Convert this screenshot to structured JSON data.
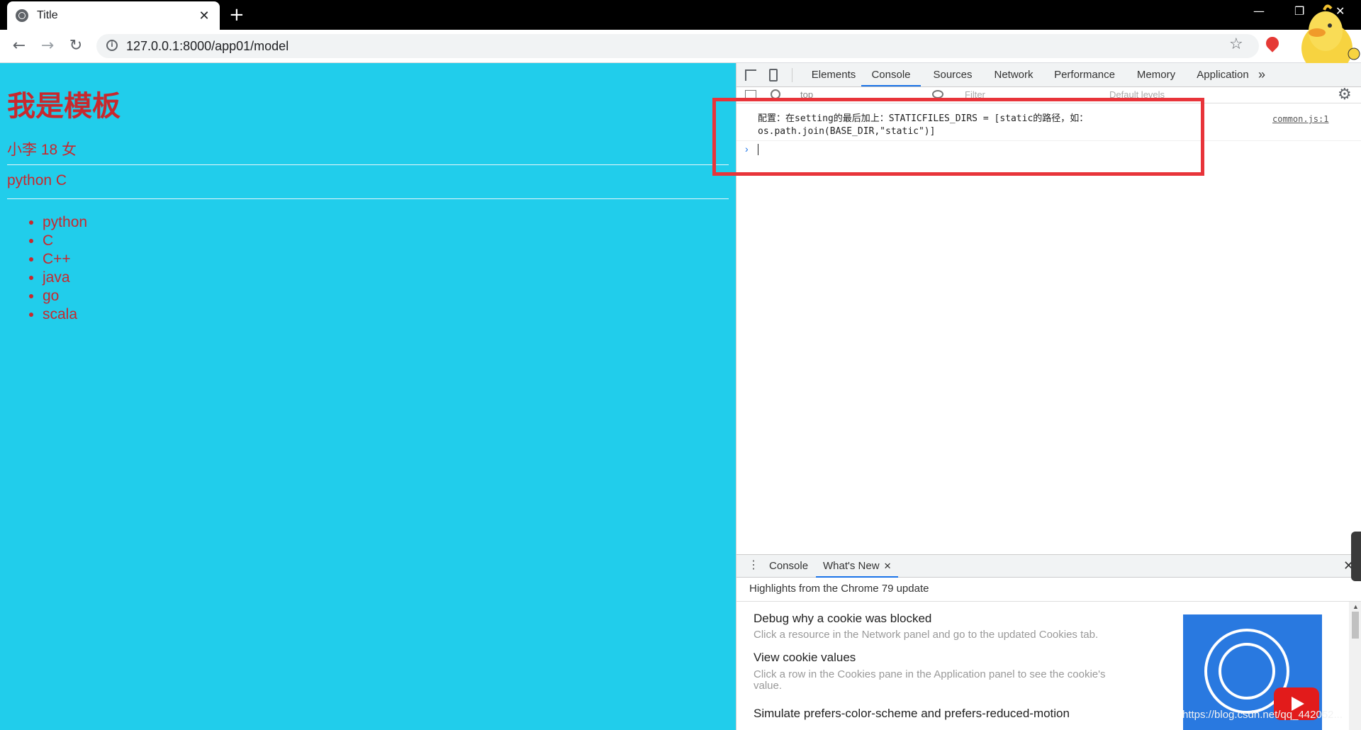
{
  "browser": {
    "tab_title": "Title",
    "tab_close": "✕",
    "new_tab": "+",
    "url": "127.0.0.1:8000/app01/model",
    "window_controls": [
      "—",
      "❐",
      "✕"
    ]
  },
  "page": {
    "heading": "我是模板",
    "person_line": "小李 18 女",
    "lang_line": "python C",
    "languages": [
      "python",
      "C",
      "C++",
      "java",
      "go",
      "scala"
    ],
    "background_color": "#21cdeb",
    "text_color": "#c8282d"
  },
  "devtools": {
    "tabs": [
      "Elements",
      "Console",
      "Sources",
      "Network",
      "Performance",
      "Memory",
      "Application"
    ],
    "active_tab": "Console",
    "more": "»",
    "context": "top",
    "filter_placeholder": "Filter",
    "levels": "Default levels",
    "console_message": "配置：在setting的最后加上：STATICFILES_DIRS = [static的路径，如：\nos.path.join(BASE_DIR,\"static\")]",
    "console_source": "common.js:1",
    "prompt": "›",
    "drawer": {
      "tabs": [
        "Console",
        "What's New"
      ],
      "active_tab": "What's New",
      "tab_close": "✕",
      "subtitle": "Highlights from the Chrome 79 update",
      "items": [
        {
          "title": "Debug why a cookie was blocked",
          "desc": "Click a resource in the Network panel and go to the updated Cookies tab."
        },
        {
          "title": "View cookie values",
          "desc": "Click a row in the Cookies pane in the Application panel to see the cookie's value."
        },
        {
          "title": "Simulate prefers-color-scheme and prefers-reduced-motion",
          "desc": ""
        }
      ]
    },
    "highlight_color": "#e8343a"
  },
  "watermark": "https://blog.csdn.net/qq_442052..."
}
